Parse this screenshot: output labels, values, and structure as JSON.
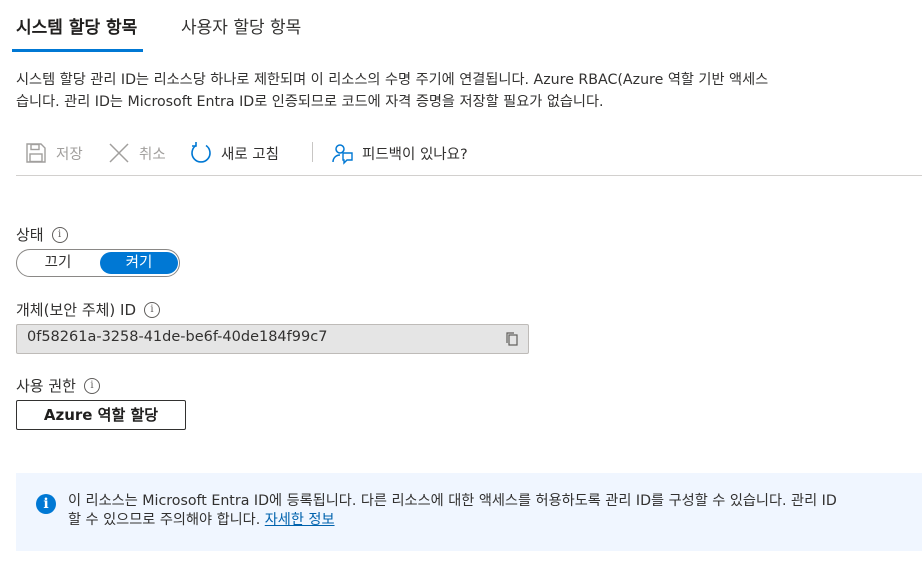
{
  "tabs": [
    {
      "label": "시스템 할당 항목",
      "active": true
    },
    {
      "label": "사용자 할당 항목",
      "active": false
    }
  ],
  "description": {
    "line1": "시스템 할당 관리 ID는 리소스당 하나로 제한되며 이 리소스의 수명 주기에 연결됩니다. Azure RBAC(Azure 역할 기반 액세스",
    "line2": "습니다. 관리 ID는 Microsoft Entra ID로 인증되므로 코드에 자격 증명을 저장할 필요가 없습니다."
  },
  "toolbar": {
    "save_label": "저장",
    "cancel_label": "취소",
    "refresh_label": "새로 고침",
    "feedback_label": "피드백이 있나요?"
  },
  "status": {
    "label": "상태",
    "off_label": "끄기",
    "on_label": "켜기",
    "selected": "켜기"
  },
  "object_id": {
    "label": "개체(보안 주체) ID",
    "value": "0f58261a-3258-41de-be6f-40de184f99c7"
  },
  "permissions": {
    "label": "사용 권한",
    "button_label": "Azure 역할 할당"
  },
  "info_banner": {
    "line1": "이 리소스는 Microsoft Entra ID에 등록됩니다. 다른 리소스에 대한 액세스를 허용하도록 관리 ID를 구성할 수 있습니다. 관리 ID",
    "line2_prefix": "할 수 있으므로 주의해야 합니다. ",
    "link": "자세한 정보"
  },
  "colors": {
    "accent": "#0078d4",
    "banner_bg": "#f0f6ff",
    "disabled": "#a19f9d"
  },
  "icons": [
    "save-icon",
    "close-icon",
    "refresh-icon",
    "feedback-icon",
    "info-icon",
    "copy-icon"
  ]
}
